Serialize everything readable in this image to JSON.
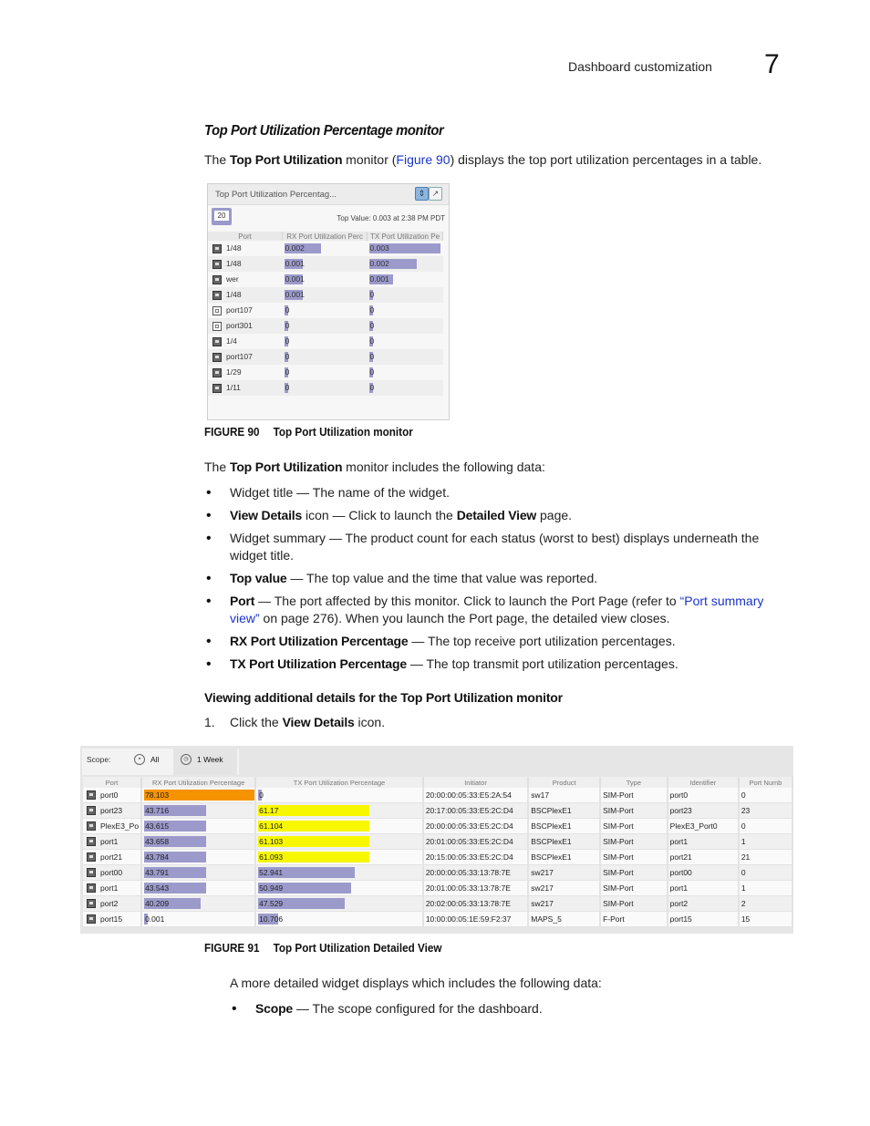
{
  "header": {
    "section": "Dashboard customization",
    "chapter": "7"
  },
  "section_title": "Top Port Utilization Percentage monitor",
  "intro": {
    "pre": "The ",
    "bold": "Top Port Utilization",
    "mid": " monitor (",
    "link": "Figure 90",
    "post": ") displays the top port utilization percentages in a table."
  },
  "colors": {
    "bar_default": "#9c9acb",
    "bar_orange": "#f59300",
    "bar_yellow": "#f7f700",
    "link": "#1a33cc"
  },
  "figure90": {
    "widget_title": "Top Port Utilization Percentag...",
    "detail_icon": "view-details-icon",
    "popout_icon": "popout-icon",
    "count_badge": "20",
    "top_value": "Top Value: 0.003 at 2:38 PM PDT",
    "columns": [
      "Port",
      "RX Port Utilization Perc",
      "TX Port Utilization Pe"
    ],
    "max_value": 0.003,
    "rows": [
      {
        "icon": "switch-port-icon",
        "port": "1/48",
        "rx": "0.002",
        "tx": "0.003"
      },
      {
        "icon": "switch-port-icon",
        "port": "1/48",
        "rx": "0.001",
        "tx": "0.002"
      },
      {
        "icon": "switch-port-icon",
        "port": "wer",
        "rx": "0.001",
        "tx": "0.001"
      },
      {
        "icon": "switch-port-icon",
        "port": "1/48",
        "rx": "0.001",
        "tx": "0"
      },
      {
        "icon": "sim-port-icon",
        "port": "port107",
        "rx": "0",
        "tx": "0"
      },
      {
        "icon": "sim-port-icon",
        "port": "port301",
        "rx": "0",
        "tx": "0"
      },
      {
        "icon": "switch-port-icon",
        "port": "1/4",
        "rx": "0",
        "tx": "0"
      },
      {
        "icon": "switch-port-icon",
        "port": "port107",
        "rx": "0",
        "tx": "0"
      },
      {
        "icon": "switch-port-icon",
        "port": "1/29",
        "rx": "0",
        "tx": "0"
      },
      {
        "icon": "switch-port-icon",
        "port": "1/11",
        "rx": "0",
        "tx": "0"
      }
    ],
    "caption_num": "FIGURE 90",
    "caption_text": "Top Port Utilization monitor"
  },
  "includes_para": {
    "pre": "The ",
    "bold": "Top Port Utilization",
    "post": " monitor includes the following data:"
  },
  "bullets": [
    {
      "bold": "",
      "text": "Widget title — The name of the widget."
    },
    {
      "bold": "View Details",
      "text": " icon — Click to launch the ",
      "bold2": "Detailed View",
      "text2": " page."
    },
    {
      "bold": "",
      "text": "Widget summary — The product count for each status (worst to best) displays underneath the widget title."
    },
    {
      "bold": "Top value",
      "text": " — The top value and the time that value was reported."
    },
    {
      "bold": "Port",
      "text": " — The port affected by this monitor. Click to launch the Port Page (refer to ",
      "link": "“Port summary view”",
      "text2": " on page 276). When you launch the Port page, the detailed view closes."
    },
    {
      "bold": "RX Port Utilization Percentage",
      "text": " — The top receive port utilization percentages."
    },
    {
      "bold": "TX Port Utilization Percentage",
      "text": " — The top transmit port utilization percentages."
    }
  ],
  "subheading": "Viewing additional details for the Top Port Utilization monitor",
  "step1": {
    "num": "1.",
    "pre": "Click the ",
    "bold": "View Details",
    "post": " icon."
  },
  "figure91": {
    "scope_label": "Scope:",
    "scope_all": "All",
    "scope_week": "1 Week",
    "columns": [
      "Port",
      "RX Port Utilization Percentage",
      "TX Port Utilization Percentage",
      "Initiator",
      "Product",
      "Type",
      "Identifier",
      "Port Numb"
    ],
    "max_value": 100,
    "rows": [
      {
        "port": "port0",
        "rx": "78.103",
        "rx_color": "orange",
        "tx": "0",
        "tx_color": "default",
        "initiator": "20:00:00:05:33:E5:2A:54",
        "product": "sw17",
        "type": "SIM-Port",
        "identifier": "port0",
        "port_num": "0"
      },
      {
        "port": "port23",
        "rx": "43.716",
        "rx_color": "default",
        "tx": "61.17",
        "tx_color": "yellow",
        "initiator": "20:17:00:05:33:E5:2C:D4",
        "product": "BSCPlexE1",
        "type": "SIM-Port",
        "identifier": "port23",
        "port_num": "23"
      },
      {
        "port": "PlexE3_Po",
        "rx": "43.615",
        "rx_color": "default",
        "tx": "61.104",
        "tx_color": "yellow",
        "initiator": "20:00:00:05:33:E5:2C:D4",
        "product": "BSCPlexE1",
        "type": "SIM-Port",
        "identifier": "PlexE3_Port0",
        "port_num": "0"
      },
      {
        "port": "port1",
        "rx": "43.658",
        "rx_color": "default",
        "tx": "61.103",
        "tx_color": "yellow",
        "initiator": "20:01:00:05:33:E5:2C:D4",
        "product": "BSCPlexE1",
        "type": "SIM-Port",
        "identifier": "port1",
        "port_num": "1"
      },
      {
        "port": "port21",
        "rx": "43.784",
        "rx_color": "default",
        "tx": "61.093",
        "tx_color": "yellow",
        "initiator": "20:15:00:05:33:E5:2C:D4",
        "product": "BSCPlexE1",
        "type": "SIM-Port",
        "identifier": "port21",
        "port_num": "21"
      },
      {
        "port": "port00",
        "rx": "43.791",
        "rx_color": "default",
        "tx": "52.941",
        "tx_color": "default",
        "initiator": "20:00:00:05:33:13:78:7E",
        "product": "sw217",
        "type": "SIM-Port",
        "identifier": "port00",
        "port_num": "0"
      },
      {
        "port": "port1",
        "rx": "43.543",
        "rx_color": "default",
        "tx": "50.949",
        "tx_color": "default",
        "initiator": "20:01:00:05:33:13:78:7E",
        "product": "sw217",
        "type": "SIM-Port",
        "identifier": "port1",
        "port_num": "1"
      },
      {
        "port": "port2",
        "rx": "40.209",
        "rx_color": "default",
        "tx": "47.529",
        "tx_color": "default",
        "initiator": "20:02:00:05:33:13:78:7E",
        "product": "sw217",
        "type": "SIM-Port",
        "identifier": "port2",
        "port_num": "2"
      },
      {
        "port": "port15",
        "rx": "0.001",
        "rx_color": "default",
        "tx": "10.706",
        "tx_color": "default",
        "initiator": "10:00:00:05:1E:59:F2:37",
        "product": "MAPS_5",
        "type": "F-Port",
        "identifier": "port15",
        "port_num": "15"
      }
    ],
    "caption_num": "FIGURE 91",
    "caption_text": "Top Port Utilization Detailed View"
  },
  "detail_para": "A more detailed widget displays which includes the following data:",
  "scope_bullet": {
    "bold": "Scope",
    "text": " — The scope configured for the dashboard."
  }
}
